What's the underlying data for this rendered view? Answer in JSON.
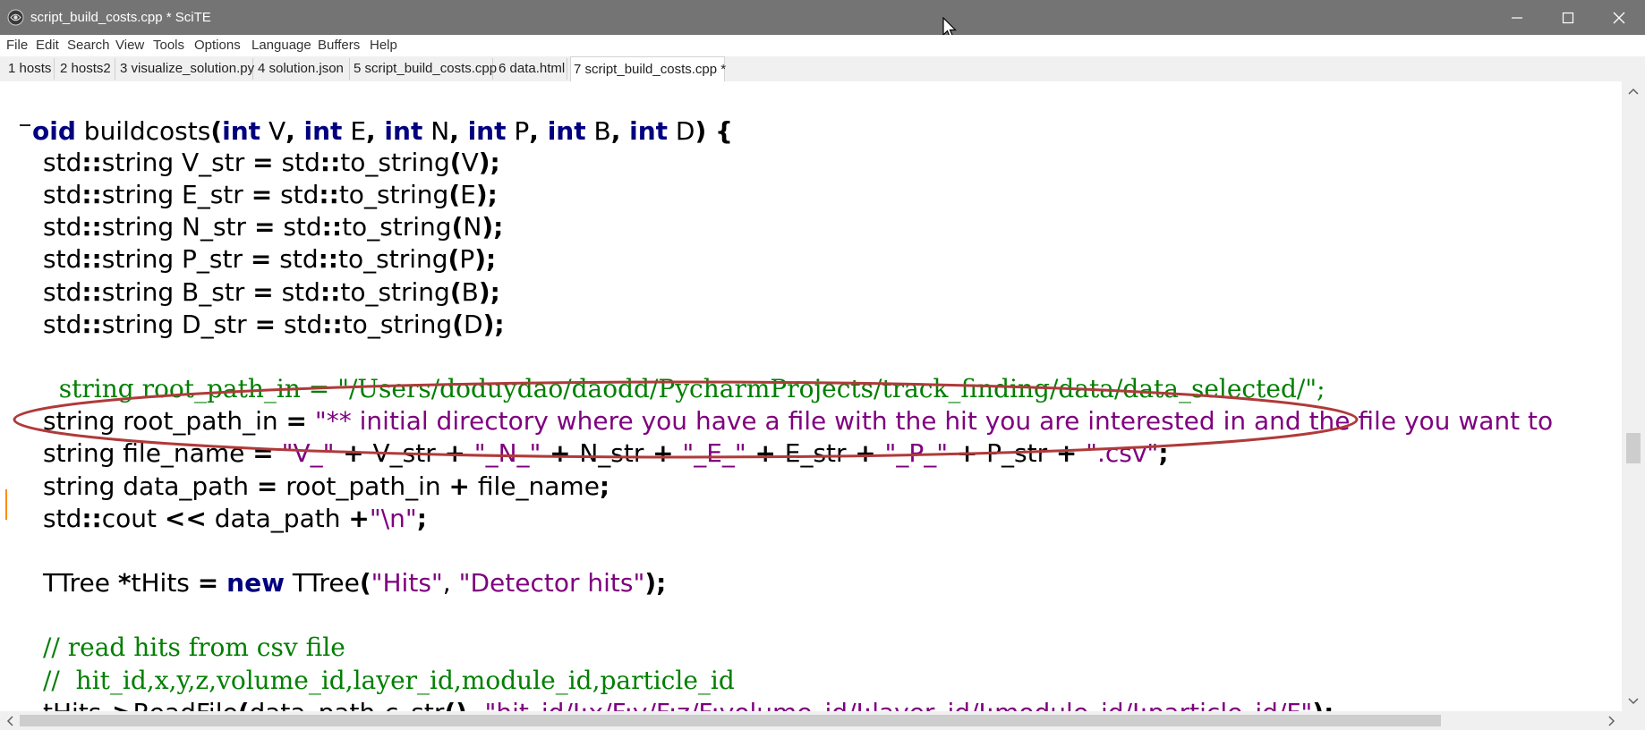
{
  "window": {
    "title": "script_build_costs.cpp * SciTE",
    "controls": [
      "minimize-icon",
      "maximize-icon",
      "close-icon"
    ]
  },
  "menu": [
    "File",
    "Edit",
    "Search",
    "View",
    "Tools",
    "Options",
    "Language",
    "Buffers",
    "Help"
  ],
  "tabs": [
    {
      "label": "1 hosts",
      "active": false
    },
    {
      "label": "2 hosts2",
      "active": false
    },
    {
      "label": "3 visualize_solution.py",
      "active": false
    },
    {
      "label": "4 solution.json",
      "active": false
    },
    {
      "label": "5 script_build_costs.cpp",
      "active": false
    },
    {
      "label": "6 data.html",
      "active": false
    },
    {
      "label": "7 script_build_costs.cpp *",
      "active": true
    }
  ],
  "colors": {
    "keyword": "#000080",
    "string": "#7f007f",
    "comment": "#007f00",
    "annotation_ellipse": "#b03a3a",
    "titlebar": "#747474"
  },
  "code": {
    "l1": {
      "a": "oid",
      "b": " buildcosts",
      "c": "(",
      "d": "int",
      "e": " V",
      "f": ", ",
      "g": "int",
      "h": " E",
      "i": ", ",
      "j": "int",
      "k": " N",
      "l": ", ",
      "m": "int",
      "n": " P",
      "o": ", ",
      "p": "int",
      "q": " B",
      "r": ", ",
      "s": "int",
      "t": " D",
      "u": ") {"
    },
    "l2": {
      "a": "std",
      "b": "::",
      "c": "string V_str ",
      "d": "=",
      "e": " std",
      "f": "::",
      "g": "to_string",
      "h": "(",
      "i": "V",
      "j": ");"
    },
    "l3": {
      "a": "std",
      "b": "::",
      "c": "string E_str ",
      "d": "=",
      "e": " std",
      "f": "::",
      "g": "to_string",
      "h": "(",
      "i": "E",
      "j": ");"
    },
    "l4": {
      "a": "std",
      "b": "::",
      "c": "string N_str ",
      "d": "=",
      "e": " std",
      "f": "::",
      "g": "to_string",
      "h": "(",
      "i": "N",
      "j": ");"
    },
    "l5": {
      "a": "std",
      "b": "::",
      "c": "string P_str ",
      "d": "=",
      "e": " std",
      "f": "::",
      "g": "to_string",
      "h": "(",
      "i": "P",
      "j": ");"
    },
    "l6": {
      "a": "std",
      "b": "::",
      "c": "string B_str ",
      "d": "=",
      "e": " std",
      "f": "::",
      "g": "to_string",
      "h": "(",
      "i": "B",
      "j": ");"
    },
    "l7": {
      "a": "std",
      "b": "::",
      "c": "string D_str ",
      "d": "=",
      "e": " std",
      "f": "::",
      "g": "to_string",
      "h": "(",
      "i": "D",
      "j": ");"
    },
    "l8": {
      "a": "  string root_path_in = \"/Users/doduydao/daodd/PycharmProjects/track_finding/data/data_selected/\";"
    },
    "l9": {
      "a": "string root_path_in ",
      "b": "=",
      "c": " \"** initial directory where you have a file with the hit you are interested in and the file you want to"
    },
    "l10": {
      "a": "string file_name ",
      "b": "=",
      "c": " \"V_\"",
      "d": " + ",
      "e": "V_str",
      "f": " + ",
      "g": "\"_N_\"",
      "h": " + ",
      "i": "N_str",
      "j": " + ",
      "k": "\"_E_\"",
      "l": " + ",
      "m": "E_str",
      "n": " + ",
      "o": "\"_P_\"",
      "p": " + ",
      "q": "P_str",
      "r": " + ",
      "s": "\".csv\"",
      "t": ";"
    },
    "l11": {
      "a": "string data_path ",
      "b": "=",
      "c": " root_path_in ",
      "d": "+",
      "e": " file_name",
      "f": ";"
    },
    "l12": {
      "a": "std",
      "b": "::",
      "c": "cout ",
      "d": "<<",
      "e": " data_path ",
      "f": "+",
      "g": "\"\\n\"",
      "h": ";"
    },
    "l13": {
      "a": "TTree ",
      "b": "*",
      "c": "tHits ",
      "d": "=",
      "e": " ",
      "f": "new",
      "g": " TTree",
      "h": "(",
      "i": "\"Hits\"",
      "j": ", ",
      "k": "\"Detector hits\"",
      "l": ");"
    },
    "l14": {
      "a": "// read hits from csv file"
    },
    "l15": {
      "a": "//  hit_id,x,y,z,volume_id,layer_id,module_id,particle_id"
    },
    "l16": {
      "a": "tHits",
      "b": "->",
      "c": "ReadFile",
      "d": "(",
      "e": "data_path",
      "f": ".",
      "g": "c_str",
      "h": "(),",
      "i": " \"hit_id/I:x/F:y/F:z/F:volume_id/I:layer_id/I:module_id/I:particle_id/F\"",
      "j": ");"
    }
  }
}
